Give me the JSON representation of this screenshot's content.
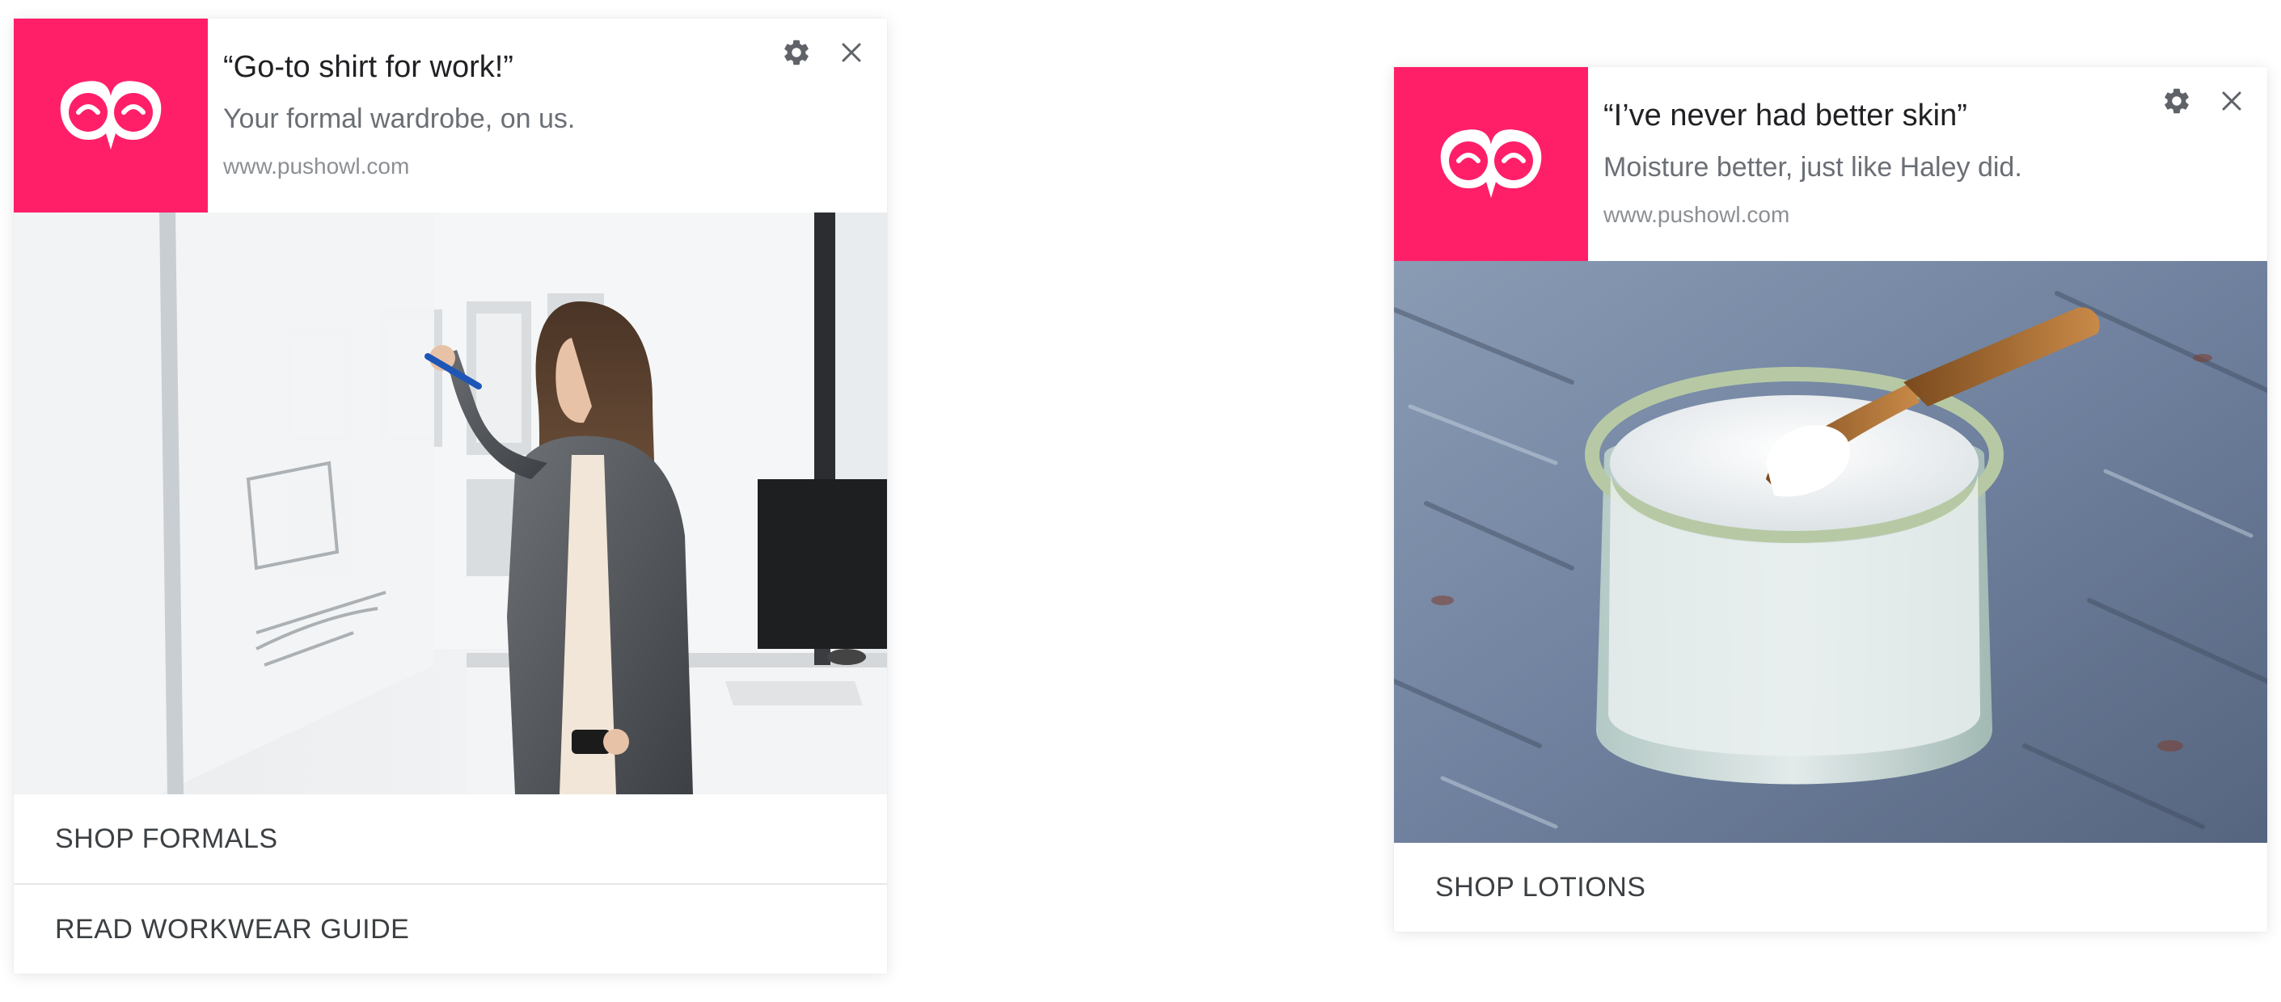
{
  "notifications": [
    {
      "title": "“Go-to shirt for work!”",
      "message": "Your formal wardrobe, on us.",
      "domain": "www.pushowl.com",
      "icon": "pushowl-owl-logo",
      "image": "woman-writing-on-whiteboard-photo",
      "actions": [
        "SHOP FORMALS",
        "READ WORKWEAR GUIDE"
      ]
    },
    {
      "title": "“I’ve never had better skin”",
      "message": "Moisture better, just like Haley did.",
      "domain": "www.pushowl.com",
      "icon": "pushowl-owl-logo",
      "image": "jar-of-lotion-with-wooden-scoop-photo",
      "actions": [
        "SHOP LOTIONS"
      ]
    }
  ],
  "colors": {
    "brand": "#ff1f69",
    "title": "#202124",
    "message": "#6b6f75",
    "domain": "#8c8f93",
    "icon": "#5f6368"
  }
}
